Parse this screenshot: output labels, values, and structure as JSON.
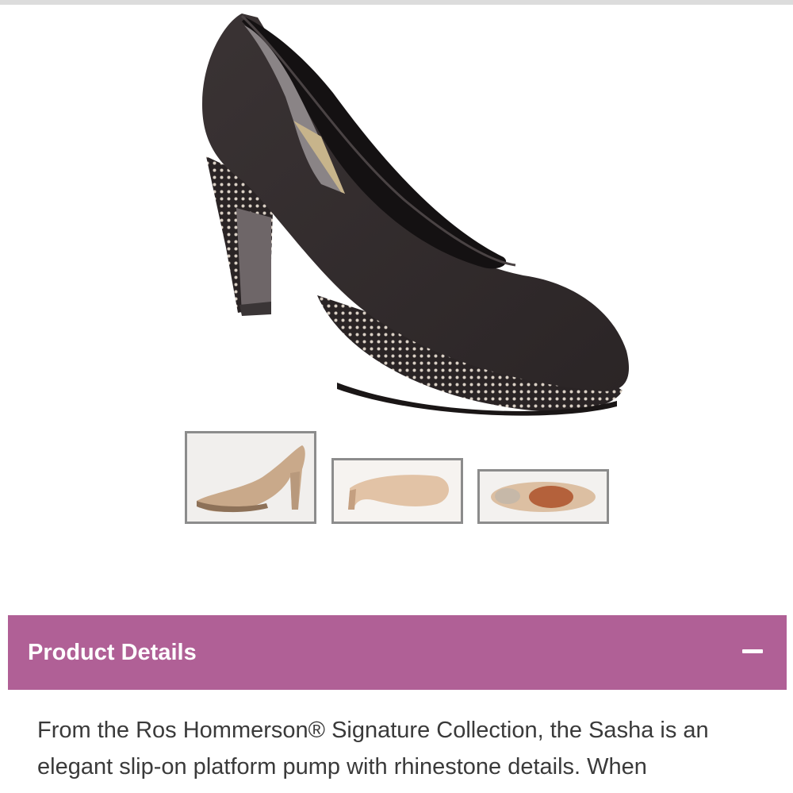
{
  "product": {
    "main_image_alt": "Black suede platform pump with rhinestone heel",
    "thumbnails": [
      {
        "name": "side-view",
        "selected": true
      },
      {
        "name": "sole-view",
        "selected": false
      },
      {
        "name": "top-view",
        "selected": false
      }
    ]
  },
  "details": {
    "title": "Product Details",
    "toggle_icon": "minus-icon",
    "description": "From the Ros Hommerson® Signature Collection, the Sasha is an elegant slip-on platform pump with rhinestone details. When"
  },
  "colors": {
    "accent": "#b06096",
    "text": "#3a3a3a",
    "thumb_border": "#8c8c8c"
  }
}
